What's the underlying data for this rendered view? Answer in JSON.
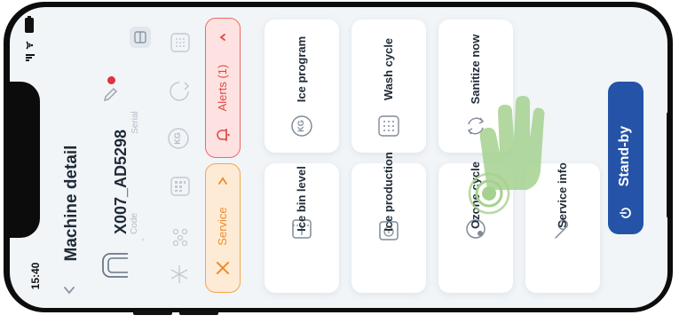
{
  "status_bar": {
    "time": "15:40"
  },
  "header": {
    "back_icon": "chevron-left-icon",
    "title": "Machine detail"
  },
  "machine": {
    "code_value": "X007_AD5298",
    "code_label": "Code",
    "code_dash": "-",
    "serial_label": "Serial",
    "status_dot_color": "#e0333b"
  },
  "buttons": {
    "service_label": "Service",
    "alerts_label": "Alerts (1)",
    "standby_label": "Stand-by"
  },
  "tiles": {
    "ice_program": "Ice program",
    "wash_cycle": "Wash cycle",
    "sanitize_now": "Sanitize now",
    "ice_bin_level": "Ice bin level",
    "ice_production": "Ice production",
    "ozone_cycle": "Ozone cycle",
    "service_info": "Service info"
  },
  "icons": {
    "kg_badge": "KG"
  },
  "colors": {
    "service_bg": "#fdebd6",
    "service_border": "#f4a64a",
    "alerts_bg": "#fde2e1",
    "alerts_border": "#ec6a64",
    "standby_bg": "#2553a8",
    "hand_overlay": "#a5d18f"
  }
}
